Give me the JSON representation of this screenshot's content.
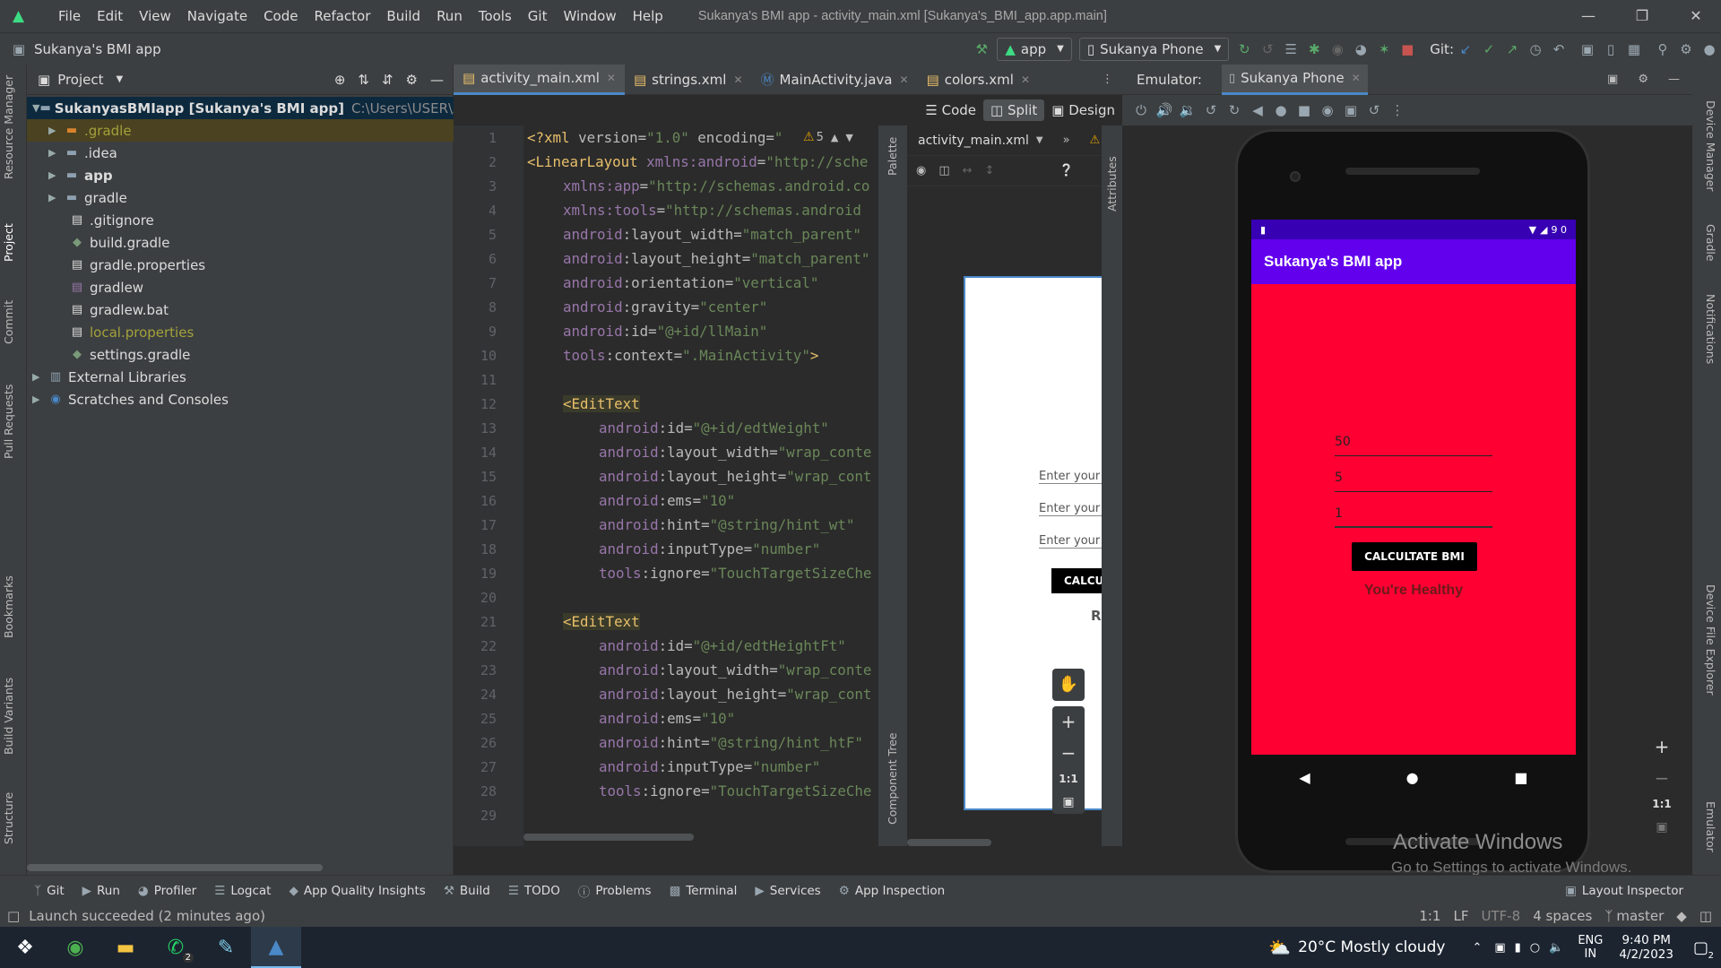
{
  "window": {
    "title": "Sukanya's BMI app - activity_main.xml [Sukanya's_BMI_app.app.main]",
    "menu": [
      "File",
      "Edit",
      "View",
      "Navigate",
      "Code",
      "Refactor",
      "Build",
      "Run",
      "Tools",
      "Git",
      "Window",
      "Help"
    ]
  },
  "toolbar": {
    "project_name": "Sukanya's BMI app",
    "run_config": "app",
    "device": "Sukanya Phone",
    "git_label": "Git:"
  },
  "left_strip": [
    "Resource Manager",
    "Project",
    "Commit",
    "Pull Requests",
    "Bookmarks",
    "Build Variants",
    "Structure"
  ],
  "project_panel": {
    "title": "Project",
    "root": "SukanyasBMIapp [Sukanya's BMI app]",
    "root_path": "C:\\Users\\USER\\AndroidS",
    "items": [
      ".gradle",
      ".idea",
      "app",
      "gradle",
      ".gitignore",
      "build.gradle",
      "gradle.properties",
      "gradlew",
      "gradlew.bat",
      "local.properties",
      "settings.gradle"
    ],
    "external": "External Libraries",
    "scratches": "Scratches and Consoles"
  },
  "editor": {
    "tabs": [
      "activity_main.xml",
      "strings.xml",
      "MainActivity.java",
      "colors.xml"
    ],
    "modes": [
      "Code",
      "Split",
      "Design"
    ],
    "warning_count": "5",
    "line_numbers": [
      "1",
      "2",
      "3",
      "4",
      "5",
      "6",
      "7",
      "8",
      "9",
      "10",
      "11",
      "12",
      "13",
      "14",
      "15",
      "16",
      "17",
      "18",
      "19",
      "20",
      "21",
      "22",
      "23",
      "24",
      "25",
      "26",
      "27",
      "28",
      "29"
    ]
  },
  "design": {
    "file": "activity_main.xml",
    "hint1": "Enter your",
    "hint2": "Enter your",
    "hint3": "Enter your",
    "button": "CALCU",
    "result": "Re",
    "zoom": "1:1",
    "palette": "Palette",
    "component_tree": "Component Tree",
    "attributes": "Attributes"
  },
  "emulator": {
    "label": "Emulator:",
    "tab": "Sukanya Phone",
    "zoom": "1:1"
  },
  "phone": {
    "status": "9 0",
    "app_title": "Sukanya's BMI app",
    "weight": "50",
    "height_ft": "5",
    "height_in": "1",
    "button": "CALCULTATE BMI",
    "result": "You're Healthy",
    "bg_color": "#ff0033",
    "appbar_color": "#6200ee"
  },
  "watermark": {
    "line1": "Activate Windows",
    "line2": "Go to Settings to activate Windows."
  },
  "right_strip": [
    "Device Manager",
    "Gradle",
    "Notifications",
    "Device File Explorer",
    "Emulator"
  ],
  "bottom_tools": [
    "Git",
    "Run",
    "Profiler",
    "Logcat",
    "App Quality Insights",
    "Build",
    "TODO",
    "Problems",
    "Terminal",
    "Services",
    "App Inspection",
    "Layout Inspector"
  ],
  "status": {
    "message": "Launch succeeded (2 minutes ago)",
    "position": "1:1",
    "line_sep": "LF",
    "encoding": "UTF-8",
    "indent": "4 spaces",
    "branch": "master"
  },
  "taskbar": {
    "weather": "20°C  Mostly cloudy",
    "lang1": "ENG",
    "lang2": "IN",
    "time": "9:40 PM",
    "date": "4/2/2023",
    "notifications": "2",
    "whatsapp_badge": "2"
  }
}
